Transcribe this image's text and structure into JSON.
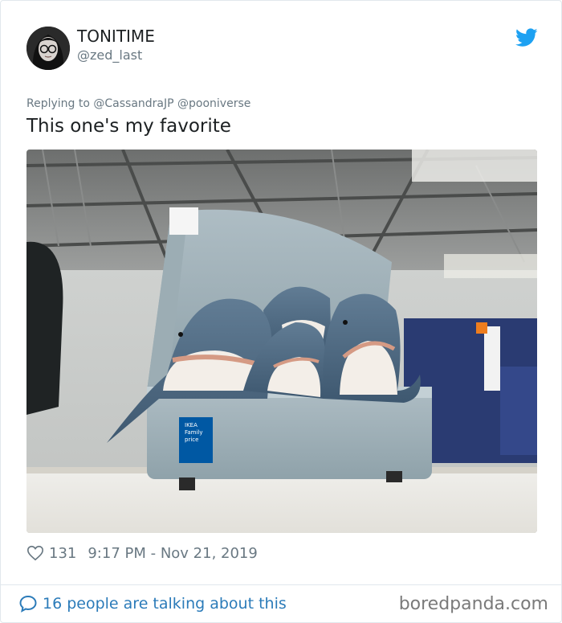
{
  "user": {
    "display_name": "TONITIME",
    "handle": "@zed_last"
  },
  "tweet": {
    "replying_to": "Replying to @CassandraJP @poониverse",
    "text": "This one's my favorite",
    "likes": "131",
    "timestamp": "9:17 PM - Nov 21, 2019"
  },
  "photo": {
    "tag_lines": [
      "IKEA",
      "Family",
      "price"
    ]
  },
  "footer": {
    "talking": "16 people are talking about this",
    "brand": "boredpanda.com"
  },
  "colors": {
    "accent": "#1da1f2",
    "link": "#2b7bb9",
    "muted": "#697882",
    "ikea_blue": "#0058a3"
  },
  "icons": [
    "twitter-bird-icon",
    "heart-icon",
    "speech-bubble-icon"
  ]
}
